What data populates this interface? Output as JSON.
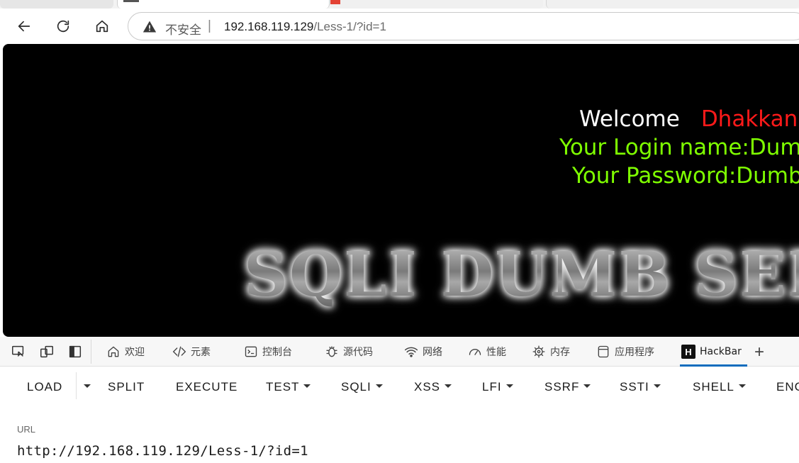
{
  "browser": {
    "security_label": "不安全",
    "separator": "|",
    "url_host": "192.168.119.129",
    "url_path": "/Less-1/?id=1"
  },
  "page": {
    "welcome_word": "Welcome",
    "welcome_name": "Dhakkan",
    "login_line": "Your Login name:Dumb",
    "password_line": "Your Password:Dumb",
    "banner_text": "SQLI DUMB SERIES",
    "colors": {
      "background": "#000000",
      "welcome": "#ffffff",
      "name": "#ff1a1a",
      "credentials": "#7fff00"
    }
  },
  "devtools": {
    "tabs": [
      {
        "label": "欢迎",
        "icon": "home-icon"
      },
      {
        "label": "元素",
        "icon": "code-icon"
      },
      {
        "label": "控制台",
        "icon": "console-icon"
      },
      {
        "label": "源代码",
        "icon": "bug-icon"
      },
      {
        "label": "网络",
        "icon": "wifi-icon"
      },
      {
        "label": "性能",
        "icon": "gauge-icon"
      },
      {
        "label": "内存",
        "icon": "chip-icon"
      },
      {
        "label": "应用程序",
        "icon": "app-icon"
      },
      {
        "label": "HackBar",
        "icon": "hackbar-icon"
      }
    ],
    "add_tab": "+",
    "accent": "#0f6cbd"
  },
  "hackbar": {
    "buttons": {
      "load": "LOAD",
      "split": "SPLIT",
      "execute": "EXECUTE",
      "test": "TEST",
      "sqli": "SQLI",
      "xss": "XSS",
      "lfi": "LFI",
      "ssrf": "SSRF",
      "ssti": "SSTI",
      "shell": "SHELL",
      "enc": "ENC"
    },
    "url_label": "URL",
    "url_value": "http://192.168.119.129/Less-1/?id=1"
  }
}
